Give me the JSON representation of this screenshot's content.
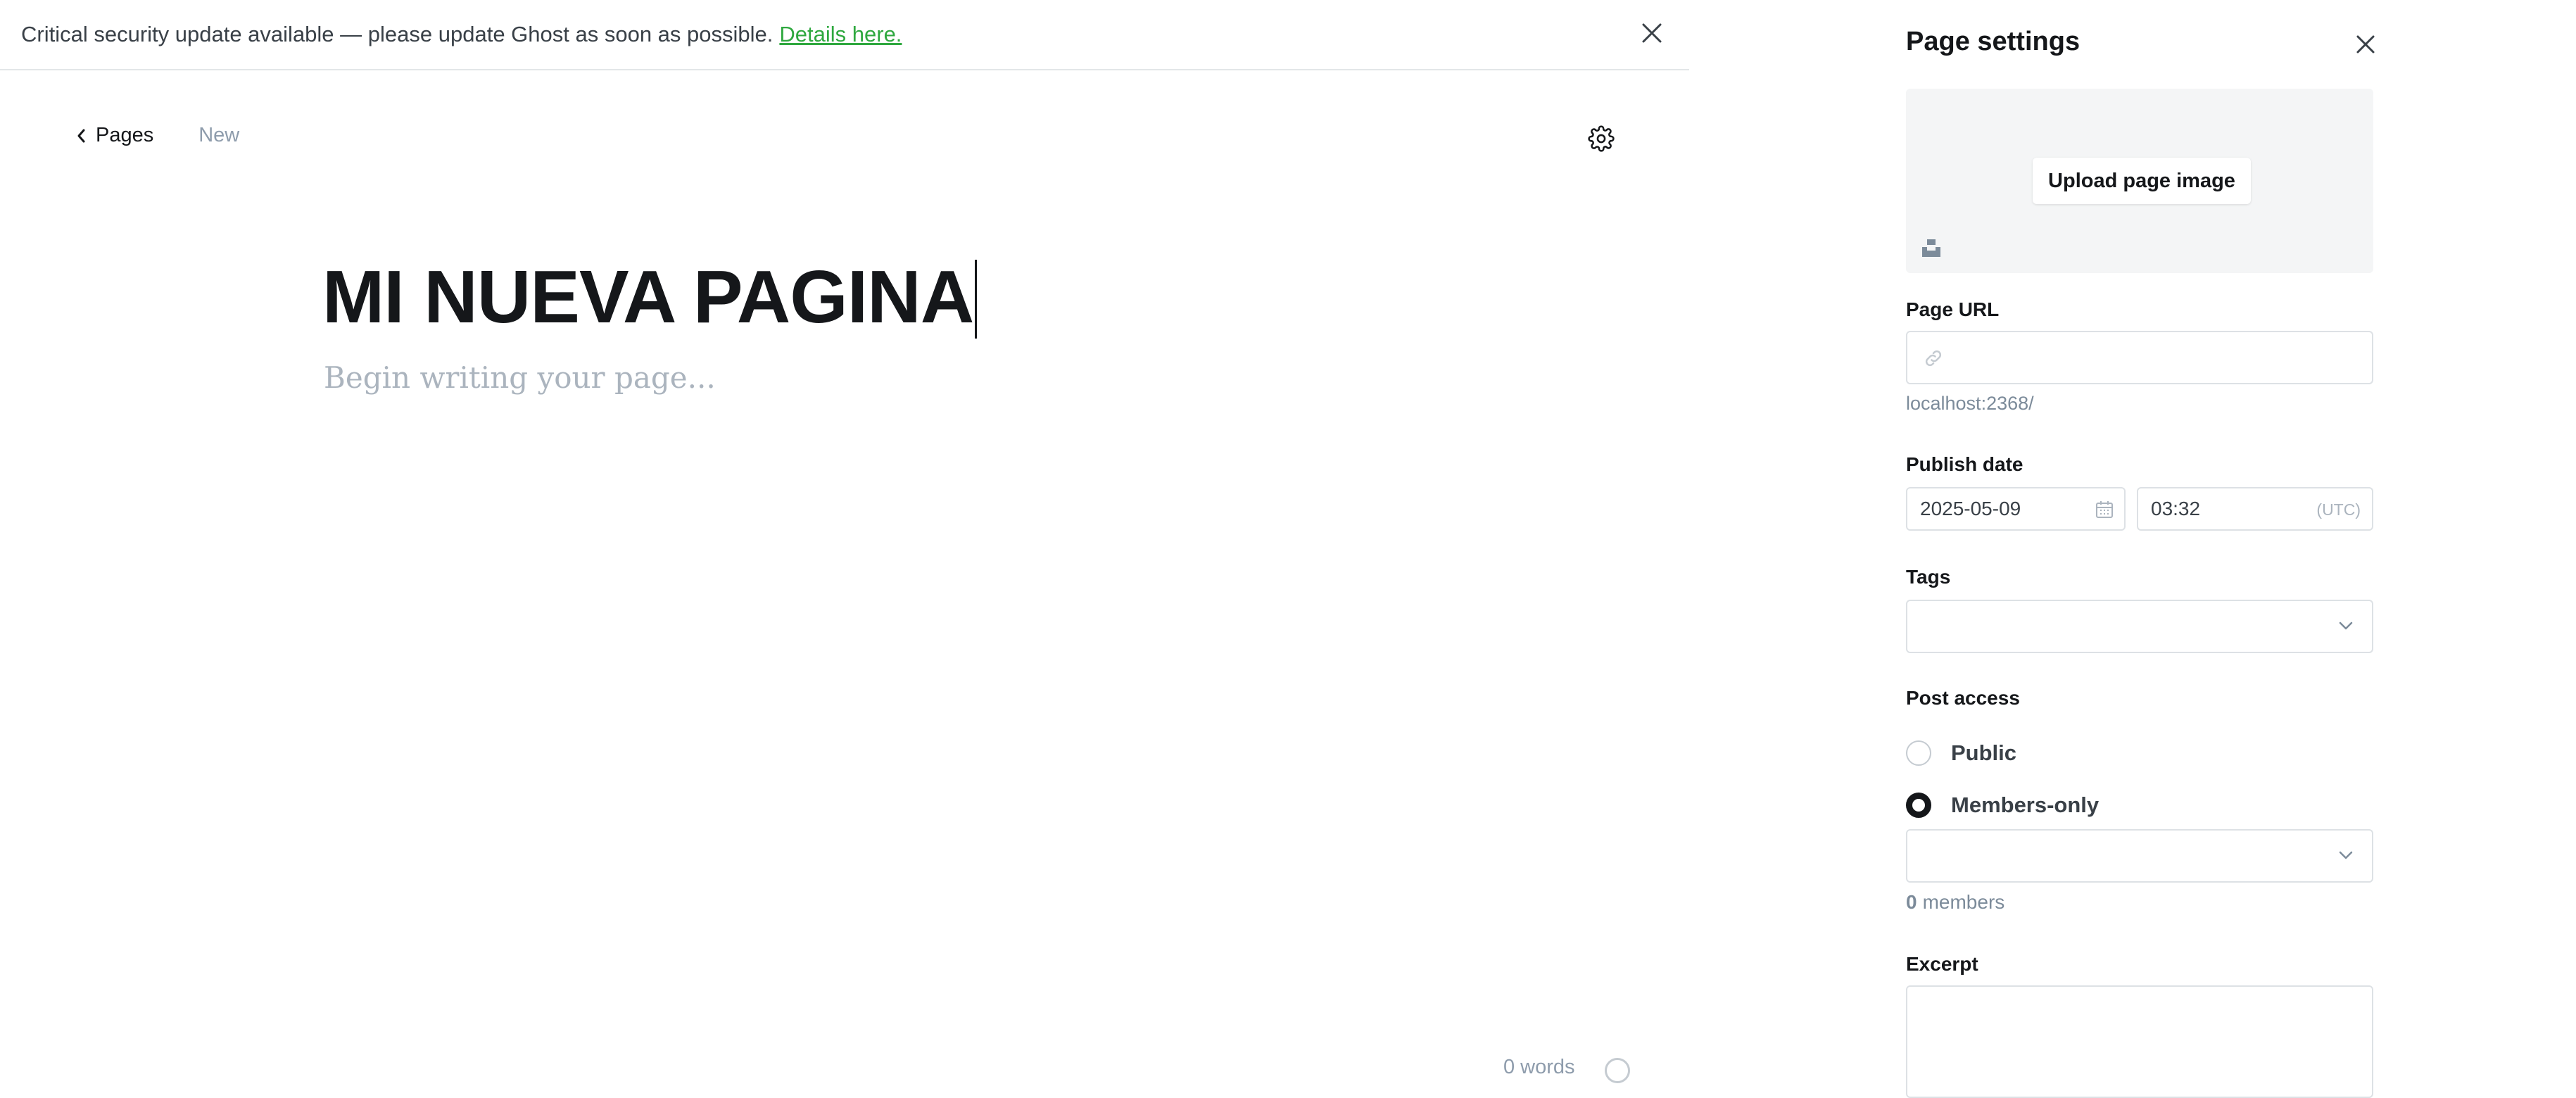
{
  "banner": {
    "message": "Critical security update available — please update Ghost as soon as possible.",
    "link_text": "Details here."
  },
  "header": {
    "back_label": "Pages",
    "status": "New"
  },
  "editor": {
    "title": "MI NUEVA PAGINA",
    "body_placeholder": "Begin writing your page...",
    "word_count": "0 words"
  },
  "panel": {
    "title": "Page settings",
    "upload_label": "Upload page image",
    "url_label": "Page URL",
    "url_value": "",
    "url_hint": "localhost:2368/",
    "publish_label": "Publish date",
    "date_value": "2025-05-09",
    "time_value": "03:32",
    "timezone": "(UTC)",
    "tags_label": "Tags",
    "access_label": "Post access",
    "access_options": [
      "Public",
      "Members-only"
    ],
    "access_selected": "Members-only",
    "members_count": "0",
    "members_suffix": "members",
    "excerpt_label": "Excerpt"
  },
  "colors": {
    "link_green": "#2fa83f",
    "text_dark": "#15171a",
    "muted": "#8e9cac",
    "border": "#dde1e5"
  },
  "icons": [
    "close-icon",
    "chevron-left-icon",
    "gear-icon",
    "unsplash-icon",
    "link-icon",
    "calendar-icon",
    "chevron-down-icon",
    "help-icon"
  ]
}
